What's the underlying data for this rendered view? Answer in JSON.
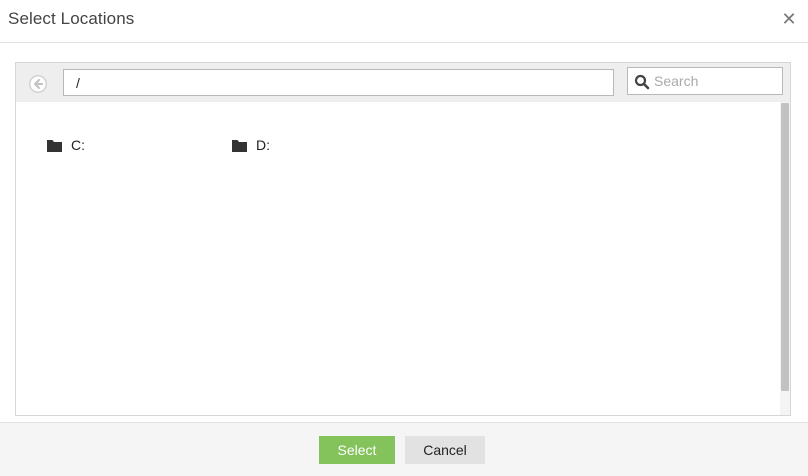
{
  "dialog": {
    "title": "Select Locations",
    "close_icon": "close-icon",
    "close_glyph": "✕"
  },
  "toolbar": {
    "back_icon": "back-arrow-icon",
    "path_value": "/",
    "search_placeholder": "Search",
    "search_icon": "search-icon"
  },
  "items": [
    {
      "label": "C:",
      "icon": "folder-icon"
    },
    {
      "label": "D:",
      "icon": "folder-icon"
    }
  ],
  "footer": {
    "select_label": "Select",
    "cancel_label": "Cancel"
  },
  "colors": {
    "select_button": "#84c25c",
    "cancel_button": "#e2e2e2",
    "toolbar_bg": "#eeeeee",
    "folder_icon": "#333333"
  }
}
